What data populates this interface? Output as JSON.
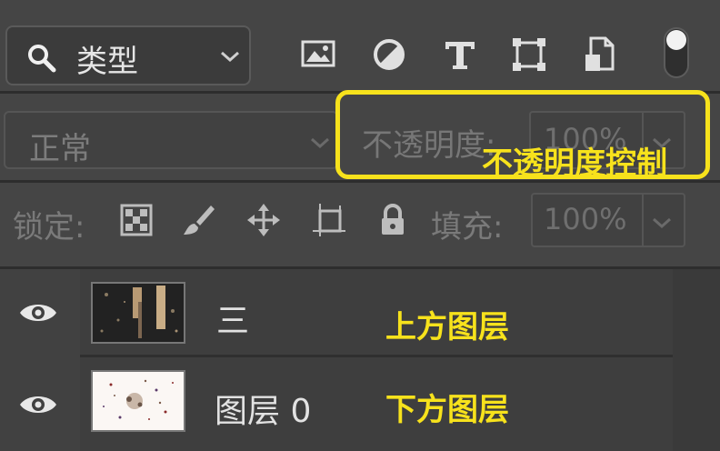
{
  "toolbar": {
    "filter_label": "类型",
    "icons": [
      "image-filter-icon",
      "adjustment-filter-icon",
      "type-filter-icon",
      "shape-filter-icon",
      "smart-object-filter-icon"
    ]
  },
  "blend": {
    "mode": "正常",
    "opacity_label": "不透明度:",
    "opacity_value": "100%"
  },
  "lock": {
    "label": "锁定:",
    "fill_label": "填充:",
    "fill_value": "100%"
  },
  "layers": [
    {
      "name": "三",
      "visible": true,
      "annotation": "上方图层"
    },
    {
      "name": "图层 0",
      "visible": true,
      "annotation": "下方图层"
    }
  ],
  "annotations": {
    "opacity": "不透明度控制"
  },
  "colors": {
    "highlight": "#f7e21c",
    "panel": "#454545"
  }
}
